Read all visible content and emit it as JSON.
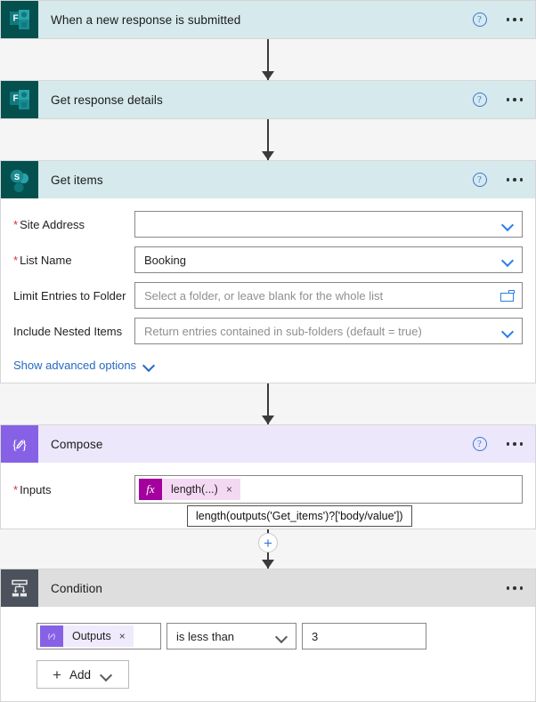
{
  "flow": {
    "steps": [
      {
        "id": "trigger-forms",
        "title": "When a new response is submitted",
        "icon": "microsoft-forms-icon",
        "theme": "teal",
        "help_label": "?",
        "menu_label": "More commands"
      },
      {
        "id": "get-response-details",
        "title": "Get response details",
        "icon": "microsoft-forms-icon",
        "theme": "teal",
        "help_label": "?",
        "menu_label": "More commands"
      },
      {
        "id": "get-items",
        "title": "Get items",
        "icon": "sharepoint-icon",
        "theme": "teal",
        "help_label": "?",
        "menu_label": "More commands"
      },
      {
        "id": "compose",
        "title": "Compose",
        "icon": "compose-icon",
        "theme": "purple",
        "help_label": "?",
        "menu_label": "More commands"
      },
      {
        "id": "condition",
        "title": "Condition",
        "icon": "condition-icon",
        "theme": "gray",
        "menu_label": "More commands"
      }
    ]
  },
  "get_items": {
    "fields": [
      {
        "label": "Site Address",
        "required": true,
        "value": "",
        "placeholder": "",
        "control": "dropdown"
      },
      {
        "label": "List Name",
        "required": true,
        "value": "Booking",
        "placeholder": "",
        "control": "dropdown"
      },
      {
        "label": "Limit Entries to Folder",
        "required": false,
        "value": "",
        "placeholder": "Select a folder, or leave blank for the whole list",
        "control": "folder-picker"
      },
      {
        "label": "Include Nested Items",
        "required": false,
        "value": "",
        "placeholder": "Return entries contained in sub-folders (default = true)",
        "control": "dropdown"
      }
    ],
    "advanced_options_label": "Show advanced options"
  },
  "compose": {
    "input_label": "Inputs",
    "input_required": true,
    "token": {
      "icon_label": "fx",
      "text": "length(...)",
      "remove_label": "×"
    },
    "tooltip": "length(outputs('Get_items')?['body/value'])"
  },
  "condition": {
    "left_token": {
      "icon_label": "{⊘}",
      "text": "Outputs",
      "remove_label": "×"
    },
    "operator": "is less than",
    "value": "3",
    "add_button_label": "Add"
  },
  "connectors": {
    "insert_label": "+"
  },
  "colors": {
    "teal_header": "#d6e9ec",
    "teal_icon": "#03504f",
    "purple_header": "#ece7fb",
    "purple_icon": "#8661e5",
    "gray_header": "#dedede",
    "gray_icon": "#4c525c",
    "link_blue": "#2668c4",
    "required_red": "#d13438",
    "token_fx": "#a4009e",
    "page_background": "#f5f5f5"
  }
}
